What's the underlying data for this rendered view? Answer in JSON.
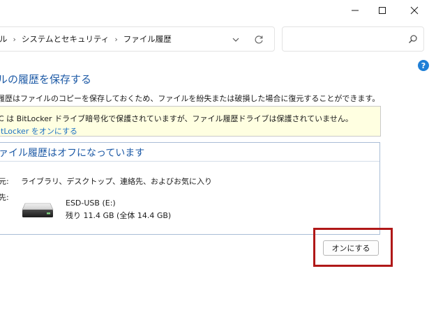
{
  "window": {
    "controls": {
      "minimize": "minimize-icon",
      "maximize": "maximize-icon",
      "close": "close-icon"
    }
  },
  "address_bar": {
    "crumbs": [
      "ル",
      "システムとセキュリティ",
      "ファイル履歴"
    ],
    "separator": "›",
    "dropdown_icon": "chevron-down-icon",
    "refresh_icon": "refresh-icon"
  },
  "search": {
    "placeholder": "",
    "icon": "search-icon"
  },
  "help": {
    "label": "?"
  },
  "main": {
    "title": "ルの履歴を保存する",
    "description": "履歴はファイルのコピーを保存しておくため、ファイルを紛失または破損した場合に復元することができます。",
    "warning": {
      "text": "C は BitLocker ドライブ暗号化で保護されていますが、ファイル履歴ドライブは保護されていません。",
      "link": "itLocker をオンにする"
    },
    "status": {
      "heading": "ァイル履歴はオフになっています",
      "copy_from_label": "元:",
      "copy_from_value": "ライブラリ、デスクトップ、連絡先、およびお気に入り",
      "copy_to_label": "先:",
      "drive_name": "ESD-USB (E:)",
      "drive_space": "残り 11.4 GB (全体 14.4 GB)"
    },
    "turn_on_button": "オンにする"
  },
  "colors": {
    "accent": "#1d5aa6",
    "link": "#1a6fc4",
    "warning_bg": "#ffffe1",
    "highlight": "#b01818",
    "help": "#1f7fd6"
  }
}
